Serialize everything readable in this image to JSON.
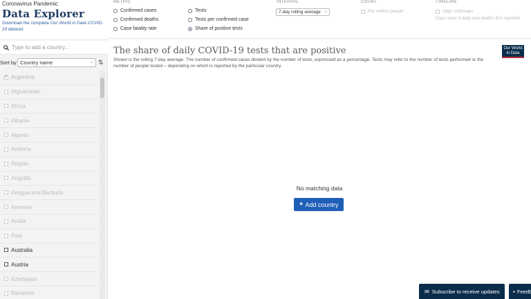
{
  "brand": {
    "supertitle": "Coronavirus Pandemic",
    "title": "Data Explorer",
    "desc_prefix": "Download the complete ",
    "desc_link": "Our World in Data COVID-19 dataset."
  },
  "controls": {
    "metric_label": "METRIC",
    "metrics": [
      {
        "label": "Confirmed cases",
        "selected": false
      },
      {
        "label": "Confirmed deaths",
        "selected": false
      },
      {
        "label": "Case fatality rate",
        "selected": false
      },
      {
        "label": "Tests",
        "selected": false
      },
      {
        "label": "Tests per confirmed case",
        "selected": false
      },
      {
        "label": "Share of positive tests",
        "selected": true
      }
    ],
    "interval_label": "INTERVAL",
    "interval_value": "7-day rolling average",
    "count_label": "COUNT",
    "per_million": "Per million people",
    "timeline_label": "TIMELINE",
    "align_outbreaks": "Align outbreaks",
    "timeline_hint": "Days since 5 daily new deaths first reported"
  },
  "sidebar": {
    "search_placeholder": "Type to add a country...",
    "sort_label": "Sort by",
    "sort_value": "Country name",
    "countries": [
      {
        "name": "Argentina",
        "checked": true,
        "active": false
      },
      {
        "name": "Afghanistan",
        "checked": false,
        "active": false
      },
      {
        "name": "Africa",
        "checked": false,
        "active": false
      },
      {
        "name": "Albania",
        "checked": false,
        "active": false
      },
      {
        "name": "Algeria",
        "checked": false,
        "active": false
      },
      {
        "name": "Andorra",
        "checked": false,
        "active": false
      },
      {
        "name": "Angola",
        "checked": false,
        "active": false
      },
      {
        "name": "Anguilla",
        "checked": false,
        "active": false
      },
      {
        "name": "Antigua and Barbuda",
        "checked": false,
        "active": false
      },
      {
        "name": "Armenia",
        "checked": false,
        "active": false
      },
      {
        "name": "Aruba",
        "checked": false,
        "active": false
      },
      {
        "name": "Asia",
        "checked": false,
        "active": false
      },
      {
        "name": "Australia",
        "checked": false,
        "active": true
      },
      {
        "name": "Austria",
        "checked": false,
        "active": true
      },
      {
        "name": "Azerbaijan",
        "checked": false,
        "active": false
      },
      {
        "name": "Bahamas",
        "checked": false,
        "active": false
      }
    ]
  },
  "chart": {
    "title": "The share of daily COVID-19 tests that are positive",
    "subtitle": "Shown is the rolling 7-day average. The number of confirmed cases divided by the number of tests, expressed as a percentage. Tests may refer to the number of tests performed or the number of people tested – depending on which is reported by the particular country.",
    "logo_text": "Our World in Data",
    "no_data": "No matching data",
    "add_country": "Add country"
  },
  "footer": {
    "subscribe": "Subscribe to receive updates",
    "feedback": "Feedback"
  },
  "colors": {
    "accent": "#1f5fb8",
    "navy": "#0b2c4b",
    "logo_red": "#c1313a"
  }
}
